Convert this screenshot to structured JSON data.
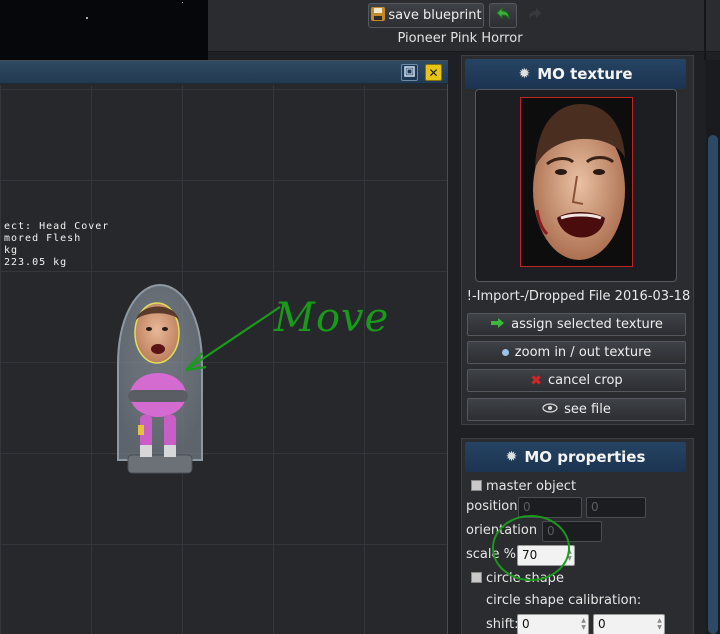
{
  "toolbar": {
    "save_label": "save blueprint",
    "blueprint_name": "Pioneer Pink Horror"
  },
  "viewport": {
    "info_lines": [
      "ect: Head Cover",
      "mored Flesh",
      "kg",
      "223.05 kg"
    ],
    "annotation_text": "Move"
  },
  "texture_panel": {
    "title": "MO texture",
    "file_label": "!-Import-/Dropped File 2016-03-18",
    "buttons": {
      "assign": "assign selected texture",
      "zoom": "zoom in / out texture",
      "cancel": "cancel crop",
      "see": "see file"
    }
  },
  "properties_panel": {
    "title": "MO properties",
    "master_object_label": "master object",
    "position_label": "position",
    "position_x": "0",
    "position_y": "0",
    "orientation_label": "orientation °",
    "orientation_value": "0",
    "scale_label": "scale %",
    "scale_value": "70",
    "circle_shape_label": "circle shape",
    "calibration_label": "circle shape calibration:",
    "shift_label": "shift:",
    "shift_x": "0",
    "shift_y": "0"
  },
  "colors": {
    "accent_blue": "#254463",
    "annotation_green": "#1a9a1a",
    "close_yellow": "#e8c414"
  }
}
